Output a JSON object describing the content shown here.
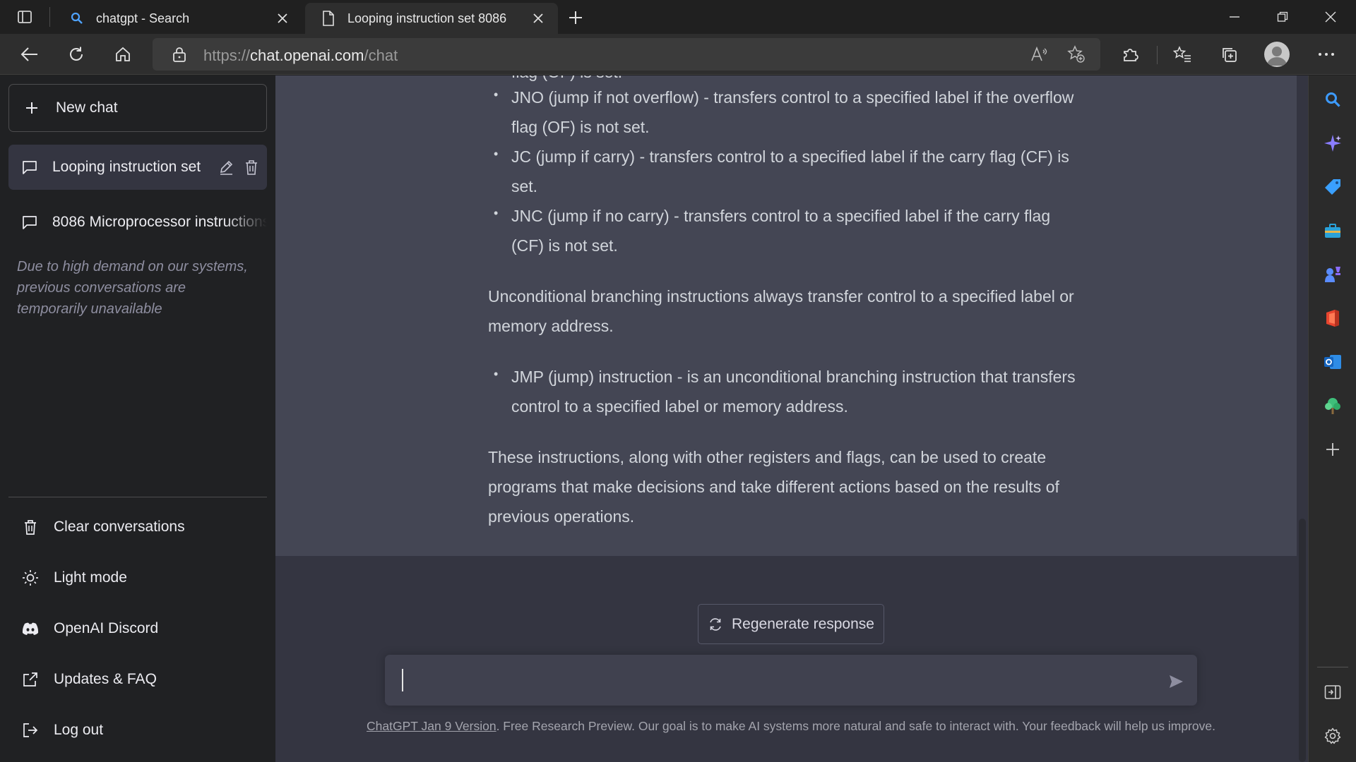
{
  "browser": {
    "tabs": [
      {
        "title": "chatgpt - Search",
        "active": false
      },
      {
        "title": "Looping instruction set 8086",
        "active": true
      }
    ],
    "address": {
      "scheme": "https://",
      "host": "chat.openai.com",
      "path": "/chat"
    }
  },
  "sidebar": {
    "new_chat_label": "New chat",
    "conversations": [
      {
        "title": "Looping instruction set",
        "selected": true
      },
      {
        "title": "8086 Microprocessor instructions",
        "selected": false
      }
    ],
    "notice": "Due to high demand on our systems, previous conversations are temporarily unavailable",
    "menu": [
      {
        "label": "Clear conversations",
        "icon": "trash-icon"
      },
      {
        "label": "Light mode",
        "icon": "sun-icon"
      },
      {
        "label": "OpenAI Discord",
        "icon": "discord-icon"
      },
      {
        "label": "Updates & FAQ",
        "icon": "external-link-icon"
      },
      {
        "label": "Log out",
        "icon": "logout-icon"
      }
    ]
  },
  "chat": {
    "partial_line": "flag (OF) is set.",
    "bullets_conditional": [
      "JNO (jump if not overflow) - transfers control to a specified label if the overflow flag (OF) is not set.",
      "JC (jump if carry) - transfers control to a specified label if the carry flag (CF) is set.",
      "JNC (jump if no carry) - transfers control to a specified label if the carry flag (CF) is not set."
    ],
    "paragraph_unconditional": "Unconditional branching instructions always transfer control to a specified label or memory address.",
    "bullets_unconditional": [
      "JMP (jump) instruction - is an unconditional branching instruction that transfers control to a specified label or memory address."
    ],
    "paragraph_final": "These instructions, along with other registers and flags, can be used to create programs that make decisions and take different actions based on the results of previous operations.",
    "regenerate_label": "Regenerate response",
    "input_value": "",
    "footer_link": "ChatGPT Jan 9 Version",
    "footer_text": ". Free Research Preview. Our goal is to make AI systems more natural and safe to interact with. Your feedback will help us improve."
  },
  "edge_sidebar": {
    "items": [
      "search-icon",
      "copilot-icon",
      "shopping-icon",
      "tools-icon",
      "games-icon",
      "office-icon",
      "outlook-icon",
      "tree-icon",
      "add-icon"
    ],
    "bottom": [
      "hide-sidebar-icon",
      "settings-icon"
    ]
  },
  "colors": {
    "sidebar_bg": "#202123",
    "chat_bg": "#343541",
    "answer_bg": "#444654",
    "composer_bg": "#40414f",
    "text": "#d1d5db"
  }
}
